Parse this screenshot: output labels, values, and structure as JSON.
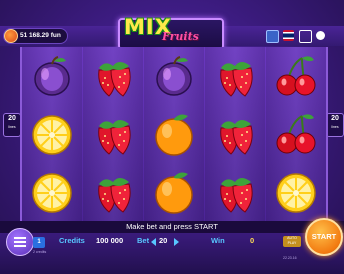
{
  "header": {
    "balance": "51 168.29 fun",
    "logo_mix": "MIX",
    "logo_fruits": "Fruits"
  },
  "reels": {
    "lines_left": "20",
    "lines_right": "20",
    "lines_caption": "lines",
    "grid": [
      [
        "plum",
        "lemon",
        "lemon"
      ],
      [
        "strawberry",
        "strawberry",
        "strawberry"
      ],
      [
        "plum",
        "orange",
        "orange"
      ],
      [
        "strawberry",
        "strawberry",
        "strawberry"
      ],
      [
        "cherry",
        "cherry",
        "lemon"
      ]
    ]
  },
  "message": "Make bet and press START",
  "bottom": {
    "bet_multiplier": "1",
    "credits_label": "Credits",
    "credits_value": "100 000",
    "bet_label": "Bet",
    "bet_value": "20",
    "win_label": "Win",
    "win_value": "0",
    "start_label": "START",
    "lines_small": "2 credits",
    "version_small": "22.23.16",
    "play_small": "AUTO PLAY"
  },
  "colors": {
    "accent": "#58c7ff",
    "start": "#f27a10",
    "background": "#3d1c82"
  }
}
